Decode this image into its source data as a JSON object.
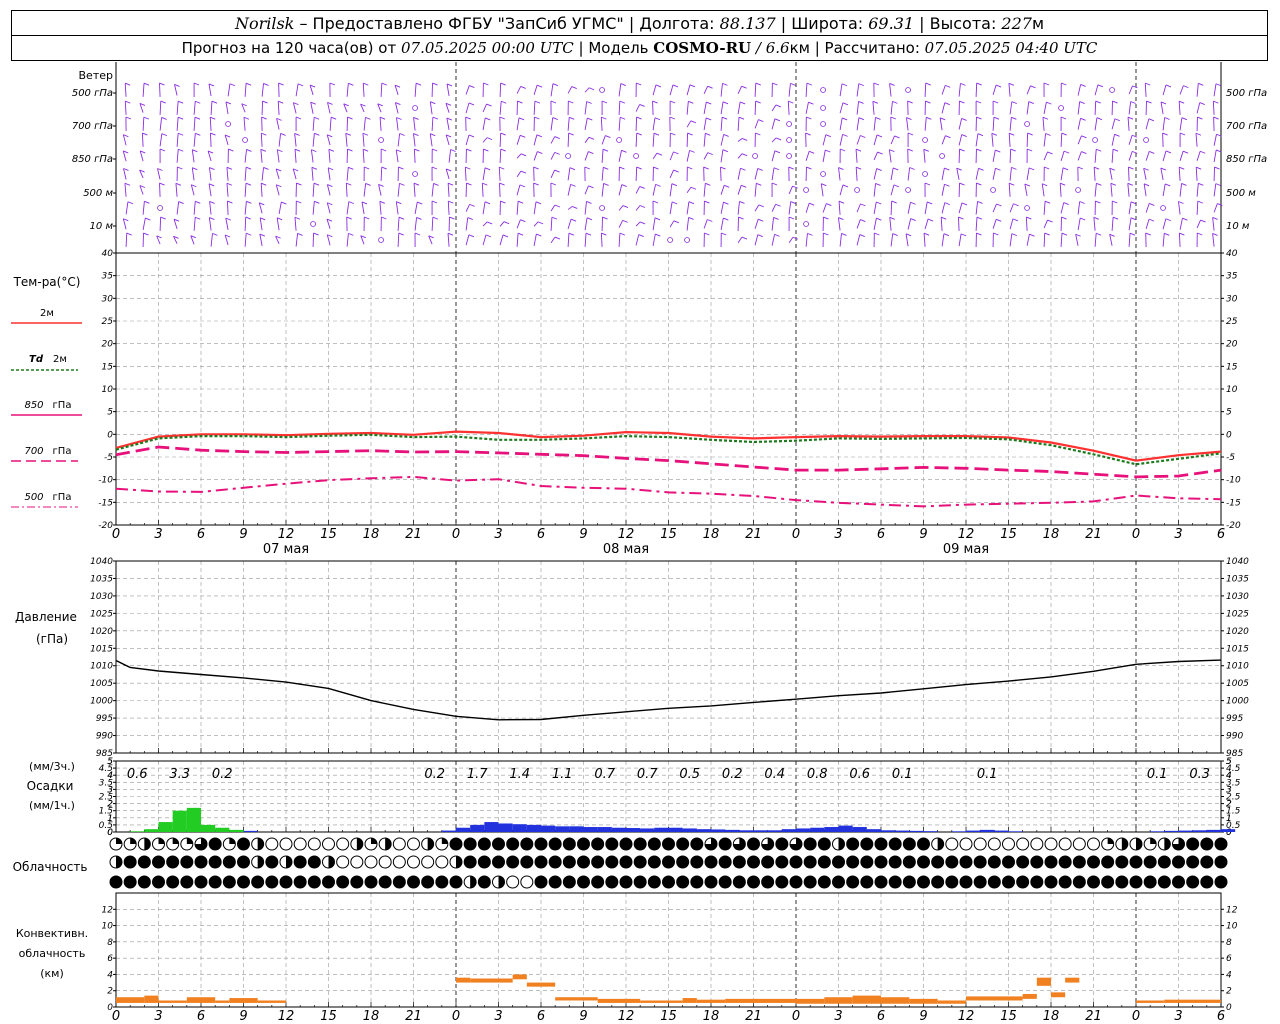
{
  "header": {
    "station": "Norilsk",
    "provider": " – Предоставлено ФГБУ \"ЗапСиб УГМС\" | Долгота: ",
    "lon": "88.137",
    "lat_label": " | Широта: ",
    "lat": "69.31",
    "alt_label": " | Высота: ",
    "alt": "227",
    "alt_unit": "м",
    "forecast_label": "Прогноз на 120 часа(ов) от ",
    "forecast_from": "07.05.2025 00:00 UTC",
    "model_label": " | Модель ",
    "model": "COSMO-RU",
    "model_res": " / 6.6",
    "model_res_unit": "км",
    "calc_label": " | Рассчитано: ",
    "calc_time": "07.05.2025 04:40 UTC"
  },
  "colors": {
    "wind": "#8a2be2",
    "t2m": "#ff3030",
    "td2m": "#1e7a1e",
    "t850": "#e8107a",
    "t700": "#e8107a",
    "t500": "#e8107a",
    "pressure": "#000000",
    "precip_green": "#22cc22",
    "precip_blue": "#2233dd",
    "convective": "#f08020"
  },
  "chart_data": [
    {
      "type": "wind-barbs",
      "ylabel": "Ветер",
      "levels": [
        "500 гПа",
        "700 гПа",
        "850 гПа",
        "500 м",
        "10 м"
      ],
      "right_levels": [
        "500 гПа",
        "700 гПа",
        "850 гПа",
        "500 м",
        "10 м"
      ]
    },
    {
      "type": "line",
      "ylabel": "Тем-ра(°C)",
      "ylim": [
        -20,
        40
      ],
      "yticks": [
        -20,
        -15,
        -10,
        -5,
        0,
        5,
        10,
        15,
        20,
        25,
        30,
        35,
        40
      ],
      "xticks": [
        "0",
        "3",
        "6",
        "9",
        "12",
        "15",
        "18",
        "21",
        "0",
        "3",
        "6",
        "9",
        "12",
        "15",
        "18",
        "21",
        "0",
        "3",
        "6",
        "9",
        "12",
        "15",
        "18",
        "21",
        "0",
        "3",
        "6"
      ],
      "day_labels": [
        {
          "hour": 12,
          "text": "07 мая"
        },
        {
          "hour": 36,
          "text": "08 мая"
        },
        {
          "hour": 60,
          "text": "09 мая"
        }
      ],
      "x_hours": [
        0,
        3,
        6,
        9,
        12,
        15,
        18,
        21,
        24,
        27,
        30,
        33,
        36,
        39,
        42,
        45,
        48,
        51,
        54,
        57,
        60,
        63,
        66,
        69,
        72,
        75,
        78
      ],
      "series": [
        {
          "name": "2м",
          "values": [
            -3,
            -0.5,
            0,
            0,
            -0.2,
            0.1,
            0.3,
            -0.1,
            0.6,
            0.3,
            -0.6,
            -0.3,
            0.5,
            0.3,
            -0.5,
            -0.9,
            -0.6,
            -0.4,
            -0.5,
            -0.4,
            -0.4,
            -0.7,
            -1.8,
            -3.6,
            -5.8,
            -4.6,
            -3.8
          ]
        },
        {
          "name": "Td 2м",
          "values": [
            -3.4,
            -0.9,
            -0.4,
            -0.4,
            -0.6,
            -0.3,
            -0.1,
            -0.6,
            -0.5,
            -1.2,
            -1.2,
            -0.9,
            -0.4,
            -0.6,
            -1.2,
            -1.7,
            -1.4,
            -0.9,
            -1.0,
            -0.9,
            -0.8,
            -1.1,
            -2.4,
            -4.4,
            -6.6,
            -5.4,
            -4.2
          ]
        },
        {
          "name": "850 гПа",
          "values": [
            -4.5,
            -2.8,
            -3.5,
            -3.8,
            -4.0,
            -3.8,
            -3.6,
            -3.9,
            -3.8,
            -4.1,
            -4.4,
            -4.7,
            -5.3,
            -5.8,
            -6.5,
            -7.2,
            -7.9,
            -7.9,
            -7.6,
            -7.3,
            -7.5,
            -7.9,
            -8.2,
            -8.8,
            -9.4,
            -9.2,
            -7.9
          ]
        },
        {
          "name": "700 гПа",
          "values": [
            -12,
            -12.6,
            -12.7,
            -11.8,
            -10.9,
            -10.1,
            -9.7,
            -9.4,
            -10.2,
            -9.9,
            -11.4,
            -11.8,
            -12.0,
            -12.8,
            -13.1,
            -13.6,
            -14.5,
            -15.1,
            -15.5,
            -15.9,
            -15.5,
            -15.3,
            -15.1,
            -14.8,
            -13.5,
            -14.1,
            -14.3
          ]
        },
        {
          "name": "500 гПа",
          "values": []
        }
      ]
    },
    {
      "type": "line",
      "ylabel": "Давление",
      "yunit": "(гПа)",
      "ylim": [
        985,
        1040
      ],
      "yticks": [
        985,
        990,
        995,
        1000,
        1005,
        1010,
        1015,
        1020,
        1025,
        1030,
        1035,
        1040
      ],
      "x_hours": [
        0,
        1,
        3,
        6,
        9,
        12,
        15,
        18,
        21,
        24,
        27,
        30,
        33,
        36,
        39,
        42,
        45,
        48,
        51,
        54,
        57,
        60,
        63,
        66,
        69,
        72,
        75,
        78
      ],
      "series": [
        {
          "name": "",
          "values": [
            1011.5,
            1009.5,
            1008.5,
            1007.5,
            1006.5,
            1005.3,
            1003.5,
            1000,
            997.5,
            995.5,
            994.5,
            994.6,
            995.8,
            996.8,
            997.8,
            998.5,
            999.5,
            1000.4,
            1001.4,
            1002.2,
            1003.4,
            1004.6,
            1005.6,
            1006.8,
            1008.4,
            1010.4,
            1011.2,
            1011.6
          ]
        }
      ]
    },
    {
      "type": "bar",
      "ylabel_top": "(мм/3ч.)",
      "ylabel_mid": "Осадки",
      "ylabel_bottom": "(мм/1ч.)",
      "ylim": [
        0,
        5
      ],
      "yticks": [
        0,
        0.5,
        1,
        1.5,
        2,
        2.5,
        3,
        3.5,
        4,
        4.5,
        5
      ],
      "ytick_labels": [
        "0",
        "1",
        "2",
        "3",
        "4",
        "5"
      ],
      "sums_3h": [
        {
          "hour": 1.5,
          "text": "0.6"
        },
        {
          "hour": 4.5,
          "text": "3.3"
        },
        {
          "hour": 7.5,
          "text": "0.2"
        },
        {
          "hour": 22.5,
          "text": "0.2"
        },
        {
          "hour": 25.5,
          "text": "1.7"
        },
        {
          "hour": 28.5,
          "text": "1.4"
        },
        {
          "hour": 31.5,
          "text": "1.1"
        },
        {
          "hour": 34.5,
          "text": "0.7"
        },
        {
          "hour": 37.5,
          "text": "0.7"
        },
        {
          "hour": 40.5,
          "text": "0.5"
        },
        {
          "hour": 43.5,
          "text": "0.2"
        },
        {
          "hour": 46.5,
          "text": "0.4"
        },
        {
          "hour": 49.5,
          "text": "0.8"
        },
        {
          "hour": 52.5,
          "text": "0.6"
        },
        {
          "hour": 55.5,
          "text": "0.1"
        },
        {
          "hour": 61.5,
          "text": "0.1"
        },
        {
          "hour": 73.5,
          "text": "0.1"
        },
        {
          "hour": 76.5,
          "text": "0.3"
        }
      ],
      "hourly": [
        0,
        0.05,
        0.2,
        0.7,
        1.5,
        1.7,
        0.5,
        0.3,
        0.15,
        0.08,
        0,
        0,
        0,
        0,
        0,
        0,
        0,
        0,
        0,
        0,
        0,
        0,
        0,
        0.1,
        0.3,
        0.5,
        0.7,
        0.6,
        0.55,
        0.5,
        0.45,
        0.4,
        0.4,
        0.35,
        0.35,
        0.3,
        0.28,
        0.25,
        0.3,
        0.3,
        0.25,
        0.2,
        0.18,
        0.15,
        0.12,
        0.12,
        0.12,
        0.2,
        0.25,
        0.3,
        0.35,
        0.45,
        0.35,
        0.2,
        0.12,
        0.1,
        0.08,
        0.06,
        0,
        0.05,
        0.1,
        0.15,
        0.1,
        0.05,
        0,
        0,
        0,
        0,
        0,
        0,
        0,
        0,
        0,
        0.05,
        0.08,
        0.1,
        0.12,
        0.15,
        0.2
      ],
      "green_until_hour": 9
    },
    {
      "type": "table",
      "ylabel": "Облачность",
      "rows": [
        "qqhqqq3fqfhoooooohqhoohqffffffffffffffffff3f3f3f3ffhffffffhoooooooooooqhhqh3fffff3fffff3ffffffffhhffff3hffffhffhffff3qqhhqqhh3q",
        "hfffffffffhfhffhoooooooohffffffffffffffffffffffffffffffffffffffffffffffffffffffffffffffffffffffhffffffffhfffffooooohffff",
        "fffffffffffffffffffffffffhfhoofffffffffffffffffffffffffffffffffffffffffffffffffffffffffffffffffffffffffffffffqooooffff"
      ]
    },
    {
      "type": "bar",
      "ylabel_1": "Конвективн.",
      "ylabel_2": "облачность",
      "ylabel_3": "(км)",
      "ylim": [
        0,
        14
      ],
      "yticks": [
        0,
        2,
        4,
        6,
        8,
        10,
        12
      ],
      "segments": [
        {
          "h0": 0,
          "h1": 2,
          "base": 0.5,
          "top": 1.2
        },
        {
          "h0": 2,
          "h1": 3,
          "base": 0.5,
          "top": 1.4
        },
        {
          "h0": 3,
          "h1": 5,
          "base": 0.5,
          "top": 0.8
        },
        {
          "h0": 5,
          "h1": 7,
          "base": 0.5,
          "top": 1.2
        },
        {
          "h0": 7,
          "h1": 8,
          "base": 0.5,
          "top": 0.8
        },
        {
          "h0": 8,
          "h1": 10,
          "base": 0.5,
          "top": 1.1
        },
        {
          "h0": 10,
          "h1": 12,
          "base": 0.5,
          "top": 0.8
        },
        {
          "h0": 24,
          "h1": 25,
          "base": 3.0,
          "top": 3.6
        },
        {
          "h0": 25,
          "h1": 28,
          "base": 3.0,
          "top": 3.5
        },
        {
          "h0": 28,
          "h1": 29,
          "base": 3.4,
          "top": 4.0
        },
        {
          "h0": 29,
          "h1": 31,
          "base": 2.5,
          "top": 3.0
        },
        {
          "h0": 31,
          "h1": 34,
          "base": 0.8,
          "top": 1.2
        },
        {
          "h0": 34,
          "h1": 37,
          "base": 0.5,
          "top": 1.0
        },
        {
          "h0": 37,
          "h1": 40,
          "base": 0.5,
          "top": 0.8
        },
        {
          "h0": 40,
          "h1": 41,
          "base": 0.5,
          "top": 1.1
        },
        {
          "h0": 41,
          "h1": 43,
          "base": 0.5,
          "top": 0.9
        },
        {
          "h0": 43,
          "h1": 48,
          "base": 0.5,
          "top": 1.0
        },
        {
          "h0": 48,
          "h1": 50,
          "base": 0.4,
          "top": 1.0
        },
        {
          "h0": 50,
          "h1": 52,
          "base": 0.4,
          "top": 1.2
        },
        {
          "h0": 52,
          "h1": 54,
          "base": 0.4,
          "top": 1.4
        },
        {
          "h0": 54,
          "h1": 56,
          "base": 0.4,
          "top": 1.2
        },
        {
          "h0": 56,
          "h1": 58,
          "base": 0.4,
          "top": 1.0
        },
        {
          "h0": 58,
          "h1": 60,
          "base": 0.4,
          "top": 0.8
        },
        {
          "h0": 60,
          "h1": 64,
          "base": 0.8,
          "top": 1.3
        },
        {
          "h0": 64,
          "h1": 65,
          "base": 1.0,
          "top": 1.6
        },
        {
          "h0": 65,
          "h1": 66,
          "base": 2.6,
          "top": 3.6
        },
        {
          "h0": 66,
          "h1": 67,
          "base": 1.2,
          "top": 1.8
        },
        {
          "h0": 67,
          "h1": 68,
          "base": 3.0,
          "top": 3.6
        },
        {
          "h0": 72,
          "h1": 74,
          "base": 0.5,
          "top": 0.8
        },
        {
          "h0": 74,
          "h1": 78,
          "base": 0.5,
          "top": 0.9
        }
      ]
    }
  ],
  "legend": {
    "t2m": "2м",
    "td_sym": "Td",
    "td": "2м",
    "t850": "850",
    "t850_unit": "гПа",
    "t700": "700",
    "t700_unit": "гПа",
    "t500": "500",
    "t500_unit": "гПа"
  }
}
